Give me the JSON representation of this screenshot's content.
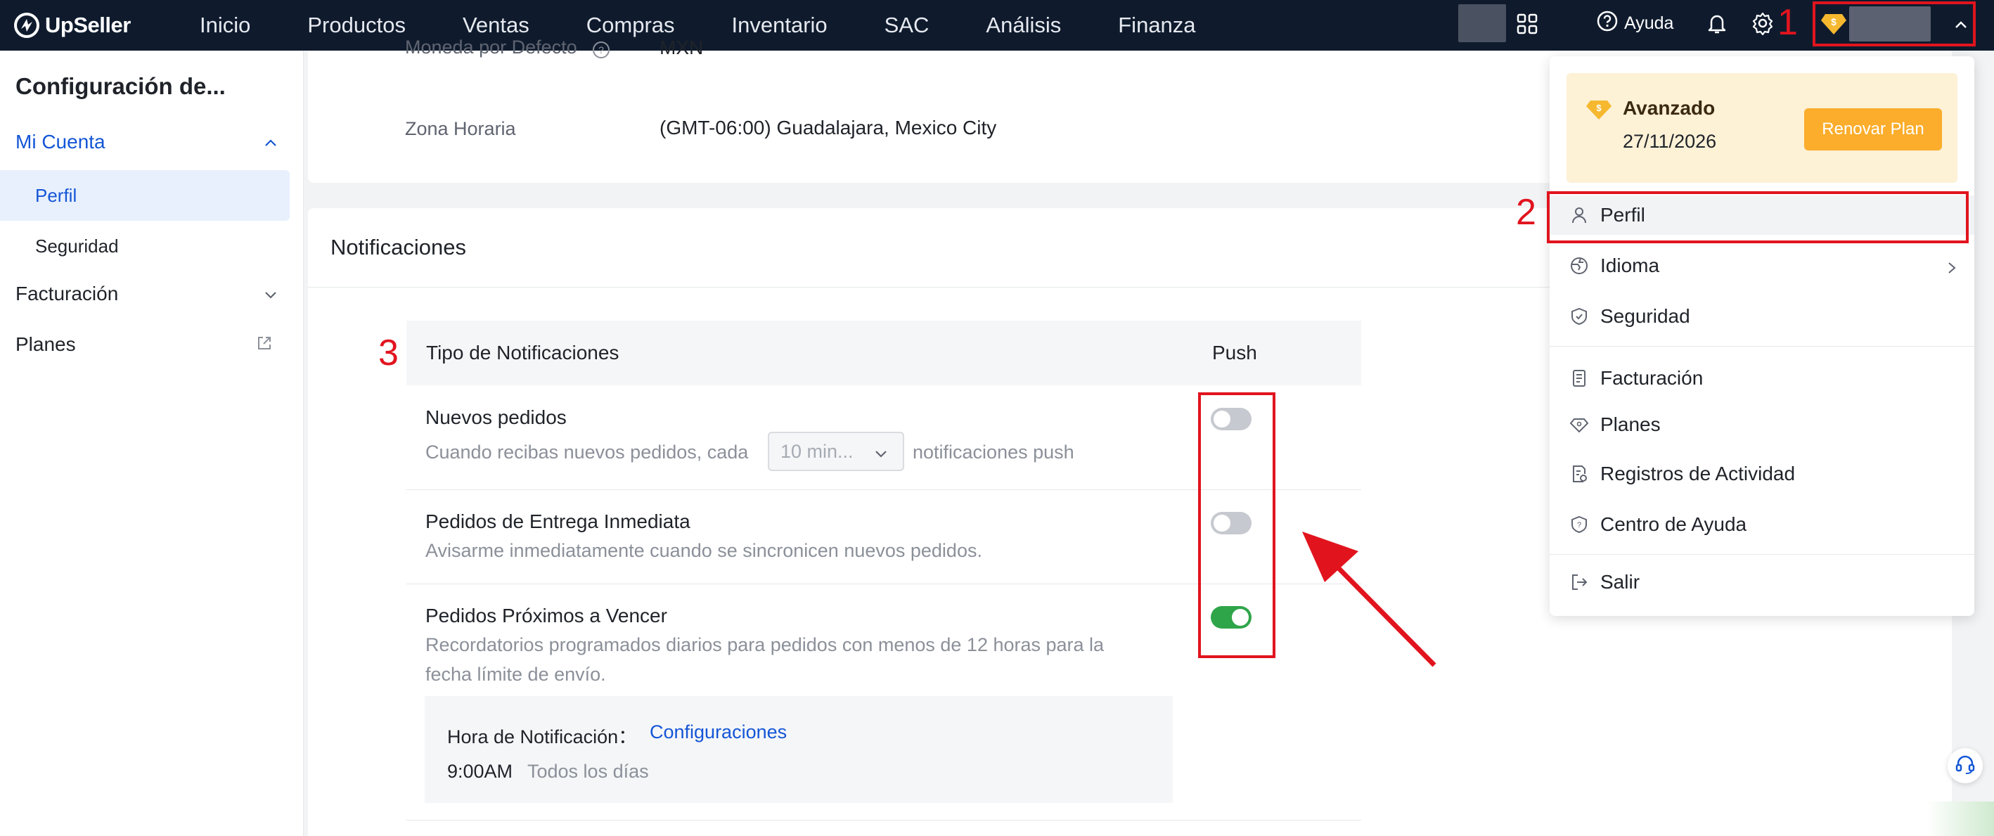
{
  "nav": {
    "brand": "UpSeller",
    "items": [
      "Inicio",
      "Productos",
      "Ventas",
      "Compras",
      "Inventario",
      "SAC",
      "Análisis",
      "Finanza"
    ],
    "help_label": "Ayuda"
  },
  "sidebar": {
    "title": "Configuración de...",
    "items": {
      "mi_cuenta": "Mi Cuenta",
      "perfil": "Perfil",
      "seguridad": "Seguridad",
      "facturacion": "Facturación",
      "planes": "Planes"
    }
  },
  "account": {
    "currency_label": "Moneda por Defecto",
    "currency_value": "MXN",
    "timezone_label": "Zona Horaria",
    "timezone_value": "(GMT-06:00) Guadalajara, Mexico City"
  },
  "notifications": {
    "title": "Notificaciones",
    "col_type": "Tipo de Notificaciones",
    "col_push": "Push",
    "rows": [
      {
        "title": "Nuevos pedidos",
        "desc_before": "Cuando recibas nuevos pedidos, cada",
        "select_value": "10 min...",
        "desc_after": "notificaciones push",
        "push_on": false
      },
      {
        "title": "Pedidos de Entrega Inmediata",
        "desc": "Avisarme inmediatamente cuando se sincronicen nuevos pedidos.",
        "push_on": false
      },
      {
        "title": "Pedidos Próximos a Vencer",
        "desc_line1": "Recordatorios programados diarios para pedidos con menos de 12 horas para la",
        "desc_line2": "fecha límite de envío.",
        "push_on": true
      }
    ],
    "schedule": {
      "label": "Hora de Notificación：",
      "link": "Configuraciones",
      "time": "9:00AM",
      "freq": "Todos los días"
    }
  },
  "dropdown": {
    "plan_name": "Avanzado",
    "plan_date": "27/11/2026",
    "renew_label": "Renovar Plan",
    "items": {
      "perfil": "Perfil",
      "idioma": "Idioma",
      "seguridad": "Seguridad",
      "facturacion": "Facturación",
      "planes": "Planes",
      "registros": "Registros de Actividad",
      "ayuda": "Centro de Ayuda",
      "salir": "Salir"
    }
  },
  "annotations": {
    "n1": "1",
    "n2": "2",
    "n3": "3"
  },
  "colors": {
    "accent": "#1456d6",
    "nav_bg": "#0f1b2d",
    "annotation_red": "#e1141e",
    "toggle_on": "#2fa54a",
    "plan_button": "#fbad2b"
  }
}
